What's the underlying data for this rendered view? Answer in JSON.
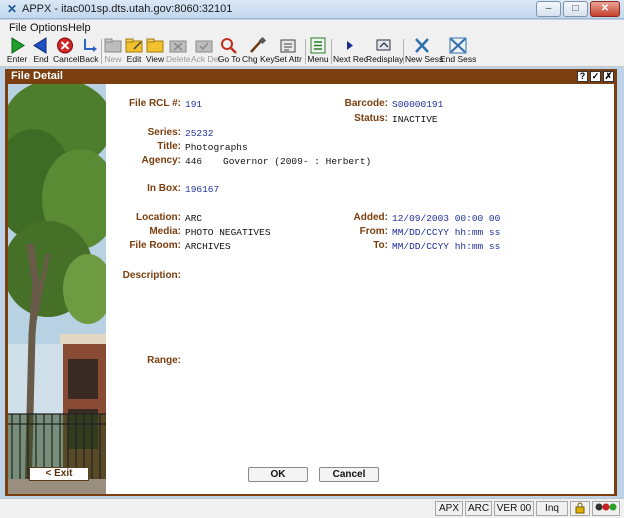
{
  "window": {
    "title": "APPX - itac001sp.dts.utah.gov:8060:32101"
  },
  "menu": [
    "File",
    "Options",
    "Help"
  ],
  "toolbar": {
    "enter": "Enter",
    "end": "End",
    "cancel": "Cancel",
    "back": "Back",
    "new": "New",
    "edit": "Edit",
    "view": "View",
    "delete": "Delete",
    "ack_del": "Ack Del",
    "go_to": "Go To",
    "chg_key": "Chg Key",
    "set_attr": "Set Attr",
    "menu": "Menu",
    "next_rec": "Next Rec",
    "redisplay": "Redisplay",
    "new_sess": "New Sess",
    "end_sess": "End Sess"
  },
  "form": {
    "title": "File Detail",
    "header_buttons": [
      "?",
      "✓",
      "✗"
    ],
    "labels": {
      "file_rcl": "File RCL #:",
      "barcode": "Barcode:",
      "status": "Status:",
      "series": "Series:",
      "title": "Title:",
      "agency": "Agency:",
      "in_box": "In Box:",
      "location": "Location:",
      "added": "Added:",
      "media": "Media:",
      "from": "From:",
      "file_room": "File Room:",
      "to": "To:",
      "description": "Description:",
      "range": "Range:"
    },
    "values": {
      "file_rcl": "191",
      "barcode": "S00000191",
      "status": "INACTIVE",
      "series": "25232",
      "title": "Photographs",
      "agency_code": "446",
      "agency_name": "Governor (2009- : Herbert)",
      "in_box": "196167",
      "location": "ARC",
      "added": "12/09/2003 00:00 00",
      "media": "PHOTO NEGATIVES",
      "from": "MM/DD/CCYY hh:mm ss",
      "file_room": "ARCHIVES",
      "to": "MM/DD/CCYY hh:mm ss"
    },
    "buttons": {
      "ok": "OK",
      "cancel": "Cancel",
      "exit": "< Exit"
    }
  },
  "statusbar": {
    "cells": [
      "APX",
      "ARC",
      "VER 00",
      "Inq"
    ]
  }
}
